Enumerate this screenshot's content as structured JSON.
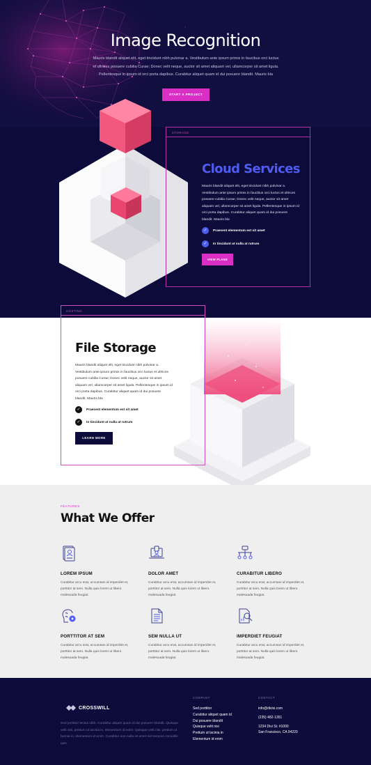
{
  "hero": {
    "eyebrow": "•",
    "title": "Image Recognition",
    "description": "Mauris blandit aliquet elit, eget tincidunt nibh pulvinar a. Vestibulum ante ipsum primis in faucibus orci luctus et ultrices posuere cubilia Curae; Donec velit neque, auctor sit amet aliquam vel, ullamcorper sit amet ligula. Pellentesque in ipsum id orci porta dapibus. Curabitur aliquet quam id dui posuere blandit. Mauris bla",
    "button": "START A PROJECT"
  },
  "cloud": {
    "tag": "STORAGE",
    "title": "Cloud Services",
    "description": "Mauris blandit aliquet elit, eget tincidunt nibh pulvinar a. Vestibulum ante ipsum primis in faucibus orci luctus et ultrices posuere cubilia Curae; Donec velit neque, auctor sit amet aliquam vel, ullamcorper sit amet ligula. Pellentesque in ipsum id orci porta dapibus. Curabitur aliquet quam id dui posuere blandit. Mauris bla",
    "checks": [
      "Praesent elementum est sit amet",
      "In tincidunt at nulla at rutrum"
    ],
    "button": "VIEW PLANS"
  },
  "storage": {
    "tag": "HOSTING",
    "title": "File Storage",
    "description": "Mauris blandit aliquet elit, eget tincidunt nibh pulvinar a. Vestibulum ante ipsum primis in faucibus orci luctus et ultrices posuere cubilia Curae; Donec velit neque, auctor sit amet aliquam vel, ullamcorper sit amet ligula. Pellentesque in ipsum id orci porta dapibus. Curabitur aliquet quam id dui posuere blandit. Mauris bla",
    "checks": [
      "Praesent elementum est sit amet",
      "In tincidunt at nulla at rutrum"
    ],
    "button": "LEARN MORE"
  },
  "features": {
    "tag": "FEATURES",
    "title": "What We Offer",
    "items": [
      {
        "name": "LOREM IPSUM",
        "icon": "id-card-icon",
        "desc": "Curabitur arcu erat, accumsan id imperdiet et, porttitor at sem. Nulla quis lorem ut libero malesuada feugiat."
      },
      {
        "name": "DOLOR AMET",
        "icon": "laptop-user-icon",
        "desc": "Curabitur arcu erat, accumsan id imperdiet et, porttitor at sem. Nulla quis lorem ut libero malesuada feugiat."
      },
      {
        "name": "CURABITUR LIBERO",
        "icon": "network-icon",
        "desc": "Curabitur arcu erat, accumsan id imperdiet et, porttitor at sem. Nulla quis lorem ut libero malesuada feugiat."
      },
      {
        "name": "PORTTITOR AT SEM",
        "icon": "brain-gear-icon",
        "desc": "Curabitur arcu erat, accumsan id imperdiet et, porttitor at sem. Nulla quis lorem ut libero malesuada feugiat."
      },
      {
        "name": "SEM NULLA UT",
        "icon": "document-icon",
        "desc": "Curabitur arcu erat, accumsan id imperdiet et, porttitor at sem. Nulla quis lorem ut libero malesuada feugiat."
      },
      {
        "name": "IMPERDIET FEUGIAT",
        "icon": "report-search-icon",
        "desc": "Curabitur arcu erat, accumsan id imperdiet et, porttitor at sem. Nulla quis lorem ut libero malesuada feugiat."
      }
    ]
  },
  "footer": {
    "logo_text": "CROSSWILL",
    "description": "Sed porttitor lectus nibh. Curabitur aliquet quam id dui posuere blandit. Quisque velit nisi, pretium ut lacinia in, elementum id enim. Quisque velit nisi, pretium ut lacinia in, elementum id enim. Curabitur non nulla sit amet nisl tempus convallis quis",
    "company_head": "COMPANY",
    "company_links": [
      "Sed porttitor",
      "Curabitur aliquet quam id",
      "Dui posuere blandit",
      "Quisque velit nisi",
      "Pretium ut lacinia in",
      "Elementum id enim"
    ],
    "contact_head": "CONTACT",
    "email": "info@divisi.com",
    "phone": "(235) 482-1351",
    "address1": "1234 Divi St. #1000",
    "address2": "San Francisco, CA 94220"
  },
  "colors": {
    "navy": "#0d0b3a",
    "magenta": "#d92fc5",
    "blue": "#4f5cf0",
    "pink_cube": "#f2587e"
  }
}
